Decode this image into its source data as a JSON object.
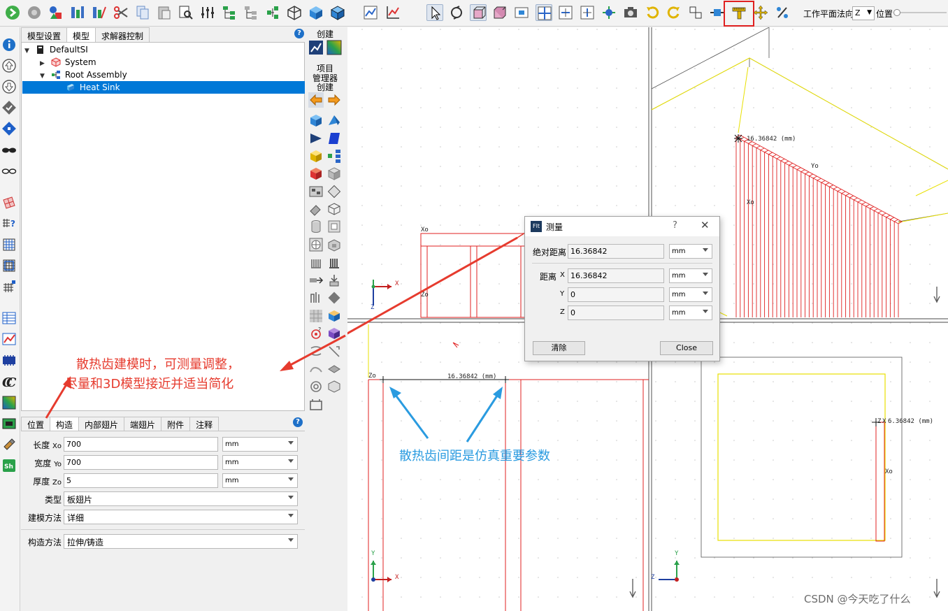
{
  "toolbar": {
    "highlight_color": "#e02020",
    "plane_label": "工作平面法向",
    "plane_axis": "Z",
    "position_label": "位置",
    "position_value": 0
  },
  "left_palette": {
    "icons": [
      "info-icon",
      "move-up-icon",
      "move-down-icon",
      "check-icon",
      "diamond-icon",
      "dark-glasses-icon",
      "glasses-icon",
      "mesh-icon",
      "grid-question-icon",
      "grid-icon",
      "grid-select-icon",
      "fine-grid-icon",
      "table-icon",
      "chart-icon",
      "pcb-icon",
      "cc-icon",
      "gradient-icon",
      "board-icon",
      "brush-icon",
      "shell-icon"
    ],
    "shell_label": "Sh"
  },
  "panel": {
    "top_tabs": [
      "模型设置",
      "模型",
      "求解器控制"
    ],
    "active_top_tab": 1,
    "tree": [
      {
        "label": "DefaultSI",
        "expanded": true
      },
      {
        "label": "System",
        "expanded": false
      },
      {
        "label": "Root Assembly",
        "expanded": true
      },
      {
        "label": "Heat Sink",
        "selected": true
      }
    ],
    "prop_tabs": [
      "位置",
      "构造",
      "内部翅片",
      "端翅片",
      "附件",
      "注释"
    ],
    "active_prop_tab": 1,
    "props": {
      "length": {
        "label": "长度",
        "axis": "Xo",
        "value": "700",
        "unit": "mm"
      },
      "width": {
        "label": "宽度",
        "axis": "Yo",
        "value": "700",
        "unit": "mm"
      },
      "thickness": {
        "label": "厚度",
        "axis": "Zo",
        "value": "5",
        "unit": "mm"
      },
      "type": {
        "label": "类型",
        "value": "板翅片"
      },
      "model_method": {
        "label": "建模方法",
        "value": "详细"
      },
      "construct_method": {
        "label": "构造方法",
        "value": "拉伸/铸造"
      }
    }
  },
  "create_strip": {
    "header_top": "创建",
    "header_mid": [
      "项目",
      "管理器",
      "创建"
    ]
  },
  "viewport": {
    "labels": {
      "xo": "Xo",
      "yo": "Yo",
      "zo": "Zo",
      "x": "X",
      "y": "Y",
      "z": "Z"
    },
    "dim_text": "16.36842 (mm)",
    "dim_text_3d": "16.36842 (mm)",
    "dim_text_right": "6.36842 (mm)",
    "zx_prefix": "Z",
    "zx_marker": "X"
  },
  "dialog": {
    "title": "测量",
    "help_icon": "?",
    "close_icon": "✕",
    "abs_label": "绝对距离",
    "abs_value": "16.36842",
    "abs_unit": "mm",
    "dist_label": "距离",
    "axes": [
      {
        "axis": "X",
        "value": "16.36842",
        "unit": "mm"
      },
      {
        "axis": "Y",
        "value": "0",
        "unit": "mm"
      },
      {
        "axis": "Z",
        "value": "0",
        "unit": "mm"
      }
    ],
    "clear_label": "清除",
    "close_label": "Close"
  },
  "annotations": {
    "red_line1": "散热齿建模时，可测量调整，",
    "red_line2": "尽量和3D模型接近并适当简化",
    "blue_text": "散热齿间距是仿真重要参数",
    "red_color": "#e63b2e",
    "blue_color": "#2a9be0"
  },
  "watermark": "CSDN @今天吃了什么"
}
